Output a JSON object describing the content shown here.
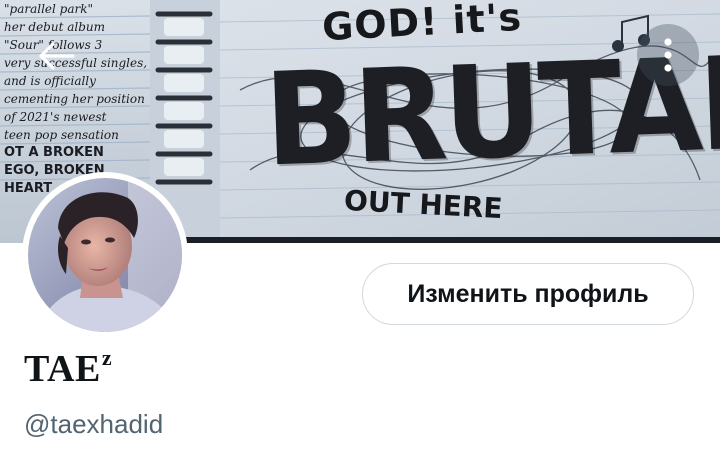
{
  "banner": {
    "headline_top": "GOD! it's",
    "headline_main": "BRUTAL",
    "headline_bottom": "OUT HERE",
    "notes": [
      "\"parallel park\"",
      "her debut album",
      "\"Sour\" follows 3",
      "very successful singles,",
      "and is officially",
      "cementing her position",
      "of 2021's newest",
      "teen pop sensation"
    ],
    "notes_caps": [
      "OT A BROKEN",
      "EGO, BROKEN",
      "HEART"
    ]
  },
  "controls": {
    "back_icon": "arrow-left-icon",
    "more_icon": "more-vertical-icon"
  },
  "profile": {
    "display_name": "TAE",
    "display_name_sup": "z",
    "handle": "@taexhadid",
    "edit_button_label": "Изменить профиль"
  },
  "colors": {
    "text_primary": "#0f1419",
    "text_secondary": "#536471",
    "button_border": "#cfd9de",
    "background": "#ffffff"
  }
}
